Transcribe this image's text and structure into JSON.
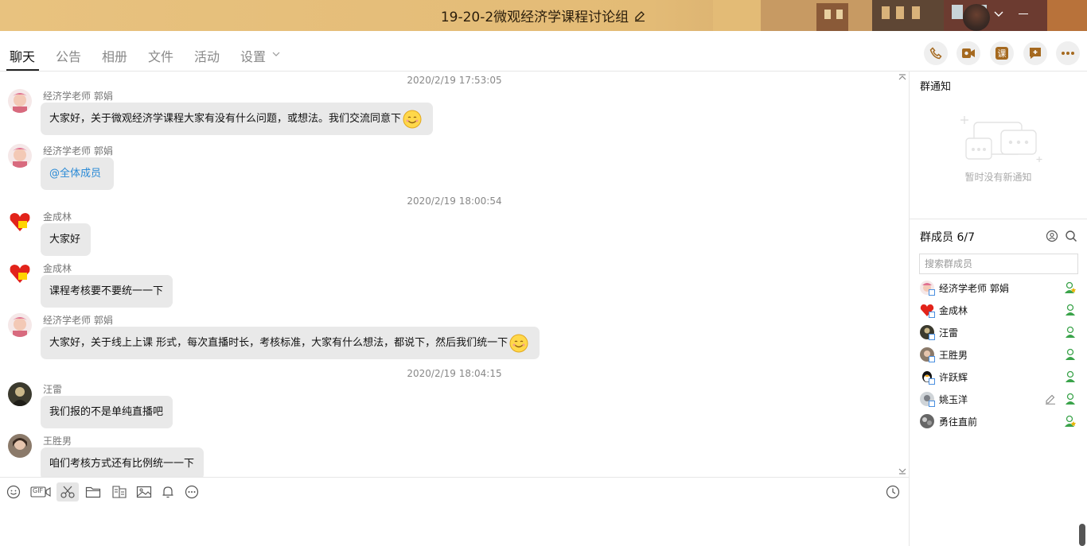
{
  "window": {
    "title": "19-20-2微观经济学课程讨论组"
  },
  "tabs": [
    {
      "label": "聊天",
      "active": true
    },
    {
      "label": "公告"
    },
    {
      "label": "相册"
    },
    {
      "label": "文件"
    },
    {
      "label": "活动"
    },
    {
      "label": "设置"
    }
  ],
  "top_actions": [
    "phone-icon",
    "video-call-icon",
    "class-icon",
    "add-comment-icon",
    "more-icon"
  ],
  "top_actions_labels": {
    "class": "课"
  },
  "chat": {
    "timestamps": [
      "2020/2/19 17:53:05",
      "2020/2/19 18:00:54",
      "2020/2/19 18:04:15"
    ],
    "messages": [
      {
        "sender": "经济学老师 郭娟",
        "text": "大家好，关于微观经济学课程大家有没有什么问题，或想法。我们交流同意下",
        "emoji": "smile"
      },
      {
        "sender": "经济学老师 郭娟",
        "text": "@全体成员"
      },
      {
        "sender": "金成林",
        "text": "大家好"
      },
      {
        "sender": "金成林",
        "text": "课程考核要不要统一一下"
      },
      {
        "sender": "经济学老师 郭娟",
        "text": "大家好，关于线上上课 形式，每次直播时长，考核标准，大家有什么想法，都说下，然后我们统一下",
        "emoji": "smile"
      },
      {
        "sender": "汪雷",
        "text": "我们报的不是单纯直播吧"
      },
      {
        "sender": "王胜男",
        "text": "咱们考核方式还有比例统一一下"
      }
    ]
  },
  "toolbar": {
    "icons": [
      "emoji-icon",
      "gif-icon",
      "screenshot-scissors-icon",
      "folder-icon",
      "doc-icon",
      "image-icon",
      "bell-icon",
      "more-circle-icon",
      "history-clock-icon"
    ],
    "gif_label": "GIF"
  },
  "notice": {
    "title": "群通知",
    "empty_text": "暂时没有新通知"
  },
  "members": {
    "title": "群成员 6/7",
    "search_placeholder": "搜索群成员",
    "list": [
      {
        "name": "经济学老师 郭娟",
        "role": "owner"
      },
      {
        "name": "金成林",
        "role": "member"
      },
      {
        "name": "汪雷",
        "role": "member"
      },
      {
        "name": "王胜男",
        "role": "member"
      },
      {
        "name": "许跃辉",
        "role": "member"
      },
      {
        "name": "姚玉洋",
        "role": "member"
      },
      {
        "name": "勇往直前",
        "role": "owner"
      }
    ]
  },
  "colors": {
    "titlebar": "#e3bb76",
    "bubble": "#e9e9e9",
    "mention": "#2a8ad6",
    "member_green": "#3aa34a",
    "owner_gold": "#e8b400"
  }
}
